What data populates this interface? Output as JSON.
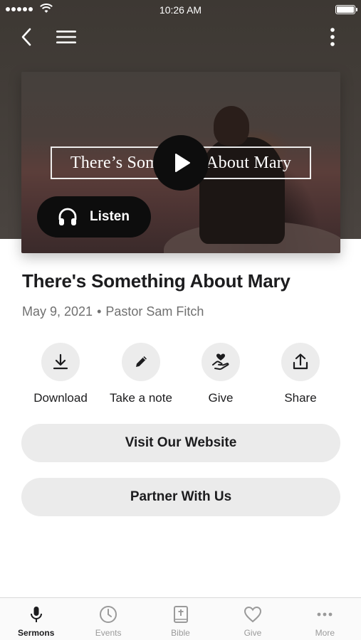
{
  "status_bar": {
    "time": "10:26 AM",
    "battery_level": 1.0
  },
  "colors": {
    "header_bg": "#3d3833",
    "button_bg": "#ebebeb",
    "text_primary": "#1c1c1e",
    "text_secondary": "#707070",
    "tab_inactive": "#9a9a9a"
  },
  "nav": {
    "back_icon": "chevron-left-icon",
    "menu_icon": "hamburger-icon",
    "more_icon": "vertical-dots-icon"
  },
  "media": {
    "title_overlay": "There’s Something About Mary",
    "play_icon": "play-icon",
    "listen_label": "Listen",
    "listen_icon": "headphones-icon"
  },
  "sermon": {
    "title": "There's Something About Mary",
    "date": "May 9, 2021",
    "separator": "•",
    "speaker": "Pastor Sam Fitch"
  },
  "actions": [
    {
      "label": "Download",
      "icon": "download-icon"
    },
    {
      "label": "Take a note",
      "icon": "pencil-icon"
    },
    {
      "label": "Give",
      "icon": "heart-hand-icon"
    },
    {
      "label": "Share",
      "icon": "share-icon"
    }
  ],
  "buttons": {
    "website": "Visit Our Website",
    "partner": "Partner With Us"
  },
  "tabs": [
    {
      "label": "Sermons",
      "icon": "microphone-icon",
      "active": true
    },
    {
      "label": "Events",
      "icon": "clock-icon",
      "active": false
    },
    {
      "label": "Bible",
      "icon": "bible-icon",
      "active": false
    },
    {
      "label": "Give",
      "icon": "heart-icon",
      "active": false
    },
    {
      "label": "More",
      "icon": "more-dots-icon",
      "active": false
    }
  ]
}
